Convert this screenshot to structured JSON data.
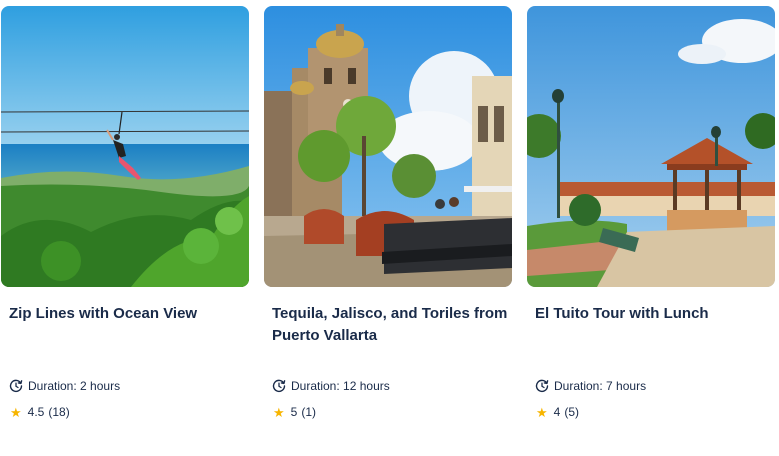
{
  "cards": [
    {
      "title": "Zip Lines with Ocean View",
      "duration_label": "Duration:",
      "duration": "2 hours",
      "rating": "4.5",
      "reviews": "(18)"
    },
    {
      "title": "Tequila, Jalisco, and Toriles from Puerto Vallarta",
      "duration_label": "Duration:",
      "duration": "12 hours",
      "rating": "5",
      "reviews": "(1)"
    },
    {
      "title": "El Tuito Tour with Lunch",
      "duration_label": "Duration:",
      "duration": "7 hours",
      "rating": "4",
      "reviews": "(5)"
    }
  ],
  "icons": {
    "duration": "clock-arrow-icon",
    "rating": "star-icon"
  },
  "colors": {
    "text": "#1a2b49",
    "star": "#f7b500"
  }
}
